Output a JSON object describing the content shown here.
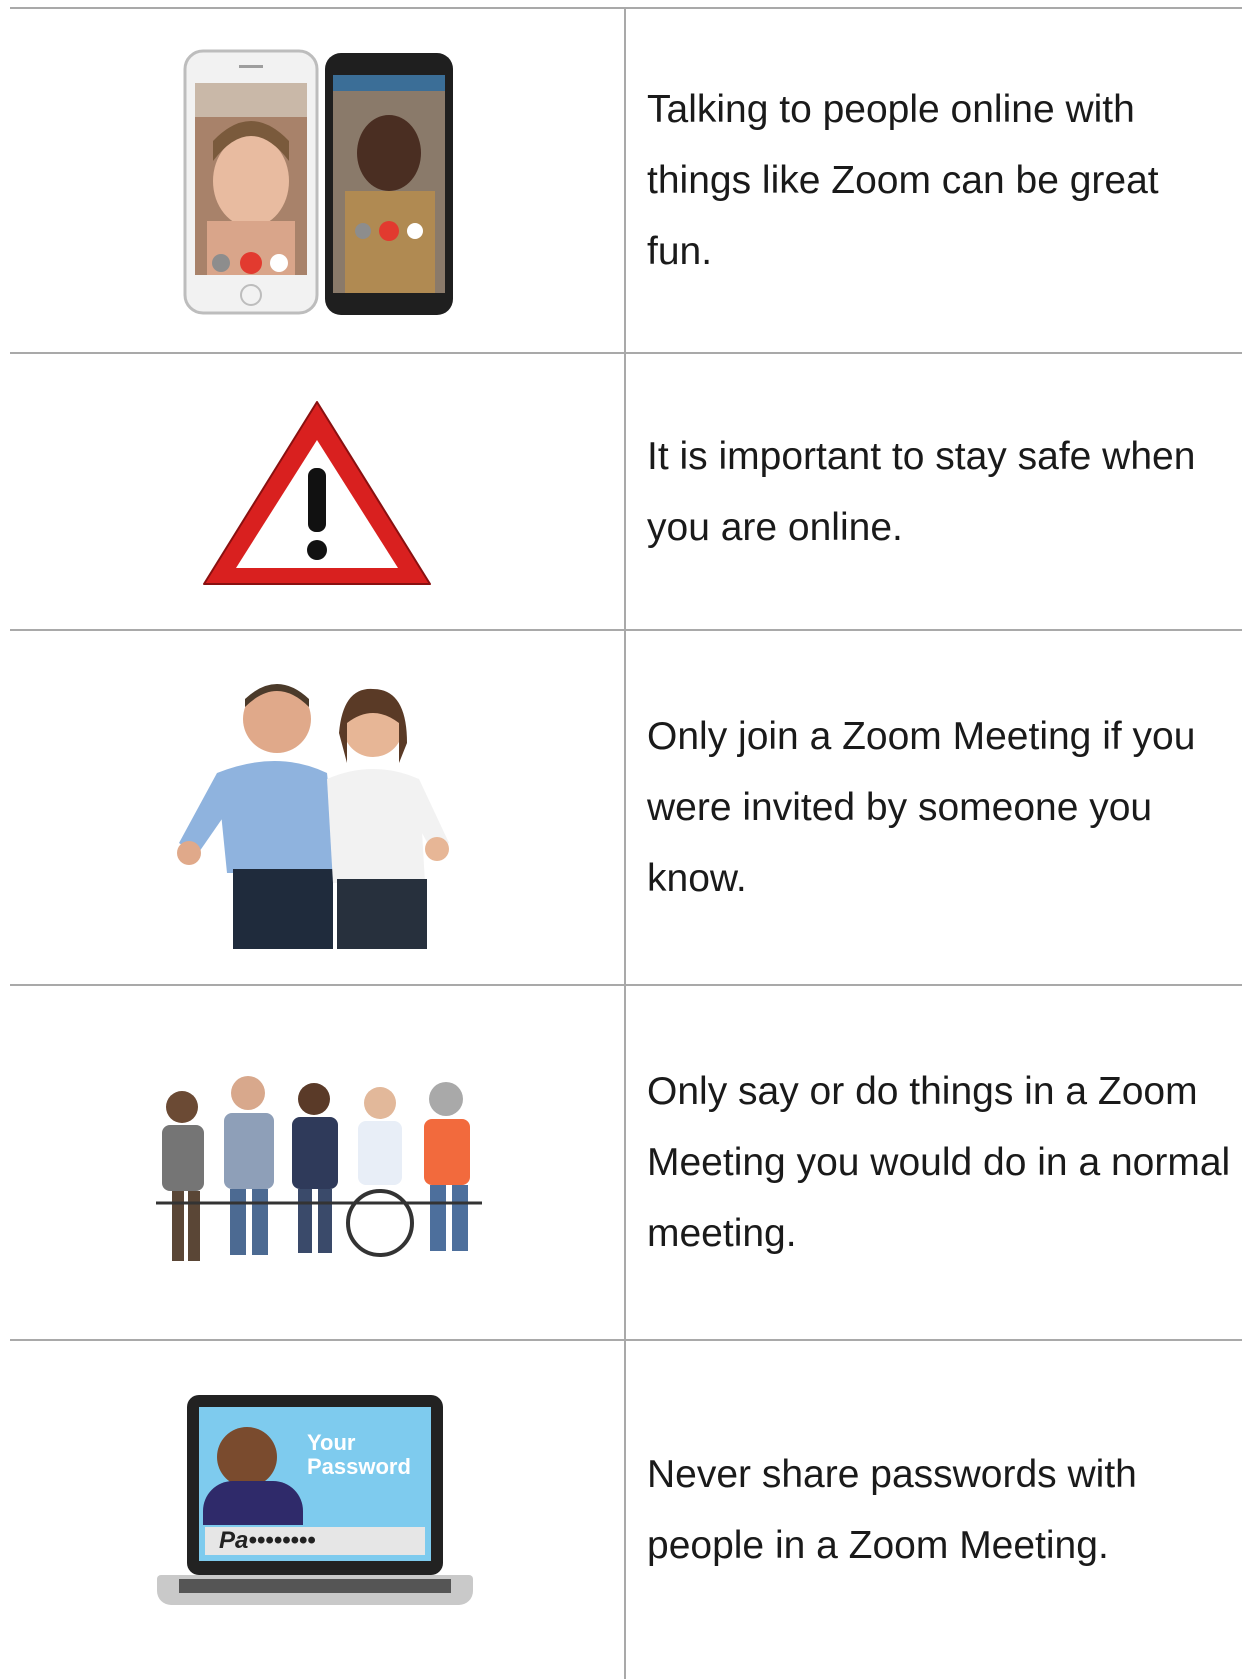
{
  "rows": [
    {
      "icon": "video-call-phones-icon",
      "text": "Talking to people online with things like Zoom can be great fun."
    },
    {
      "icon": "warning-triangle-icon",
      "text": "It is important to stay safe when you are online."
    },
    {
      "icon": "people-thumbs-up-icon",
      "text": "Only join a Zoom Meeting if you were invited by someone you know."
    },
    {
      "icon": "group-meeting-icon",
      "text": "Only say or do things in a Zoom Meeting you would do in a normal meeting."
    },
    {
      "icon": "laptop-password-icon",
      "text": "Never share passwords with people in a Zoom Meeting.",
      "laptop_heading_1": "Your",
      "laptop_heading_2": "Password",
      "laptop_password": "Pa••••••••"
    }
  ],
  "colors": {
    "border": "#a9a9a9",
    "warning_red": "#d9201f",
    "laptop_screen": "#7ecbee"
  }
}
